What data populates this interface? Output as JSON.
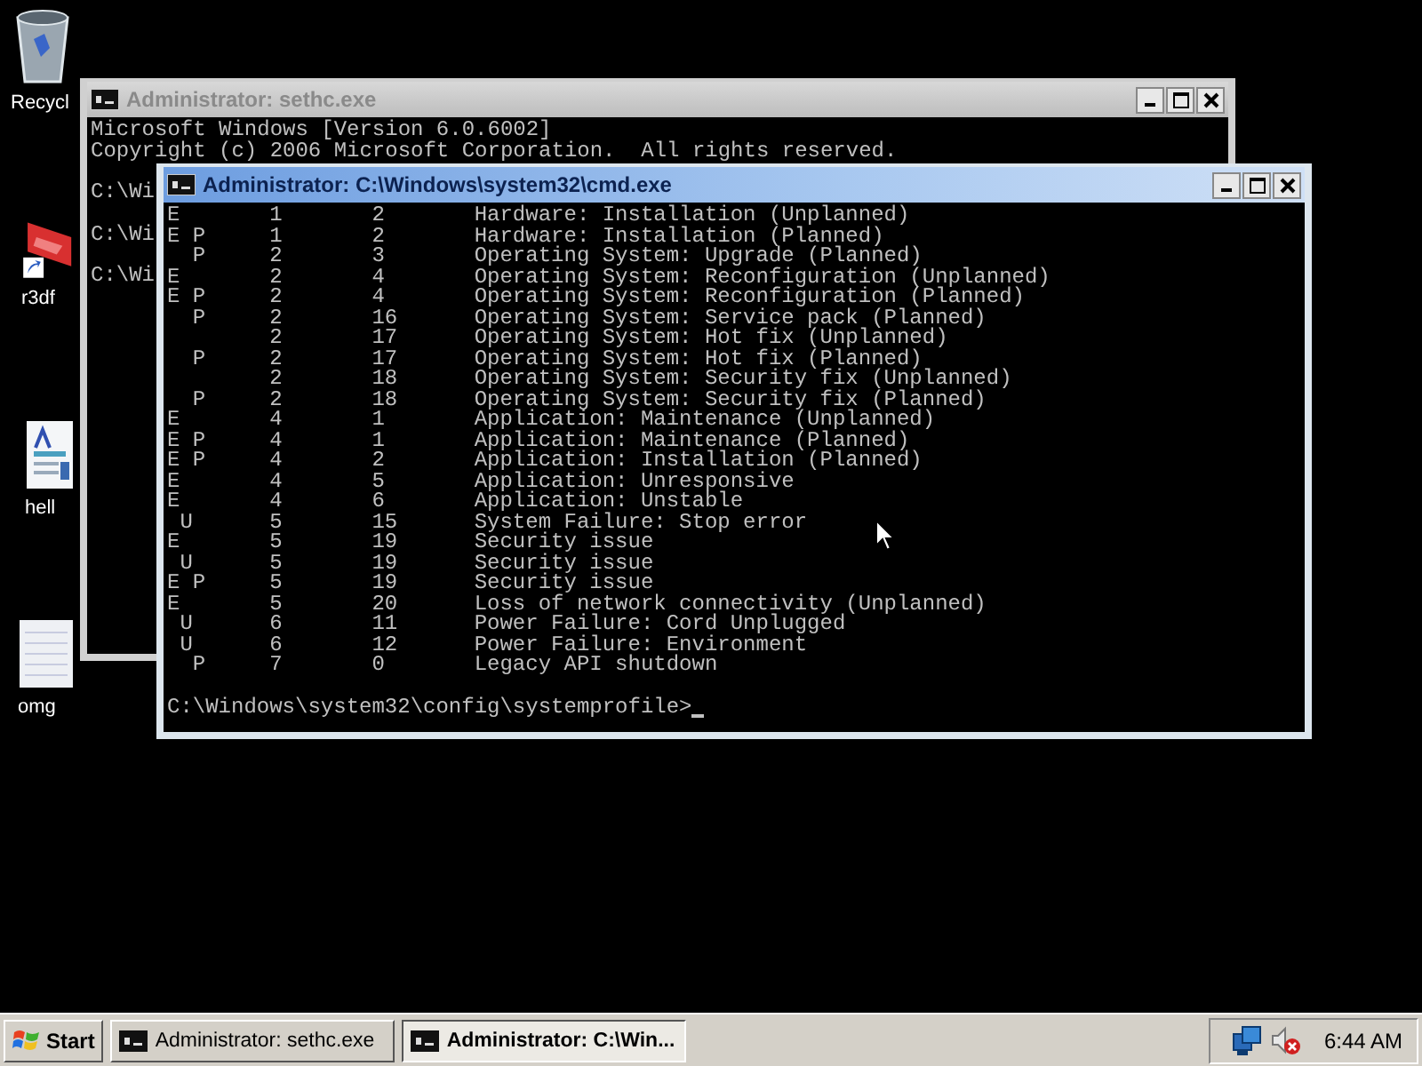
{
  "desktop": {
    "icons": [
      {
        "label": "Recycl",
        "kind": "recycle"
      },
      {
        "label": "r3df",
        "kind": "shortcut"
      },
      {
        "label": "hell",
        "kind": "document"
      },
      {
        "label": "omg",
        "kind": "text"
      }
    ]
  },
  "windows": [
    {
      "title": "Administrator: sethc.exe",
      "active": false,
      "header": [
        "Microsoft Windows [Version 6.0.6002]",
        "Copyright (c) 2006 Microsoft Corporation.  All rights reserved."
      ],
      "prompts": [
        "C:\\Wi",
        "C:\\Wi",
        "C:\\Wi"
      ]
    },
    {
      "title": "Administrator: C:\\Windows\\system32\\cmd.exe",
      "active": true,
      "lines": [
        "E       1       2       Hardware: Installation (Unplanned)",
        "E P     1       2       Hardware: Installation (Planned)",
        "  P     2       3       Operating System: Upgrade (Planned)",
        "E       2       4       Operating System: Reconfiguration (Unplanned)",
        "E P     2       4       Operating System: Reconfiguration (Planned)",
        "  P     2       16      Operating System: Service pack (Planned)",
        "        2       17      Operating System: Hot fix (Unplanned)",
        "  P     2       17      Operating System: Hot fix (Planned)",
        "        2       18      Operating System: Security fix (Unplanned)",
        "  P     2       18      Operating System: Security fix (Planned)",
        "E       4       1       Application: Maintenance (Unplanned)",
        "E P     4       1       Application: Maintenance (Planned)",
        "E P     4       2       Application: Installation (Planned)",
        "E       4       5       Application: Unresponsive",
        "E       4       6       Application: Unstable",
        " U      5       15      System Failure: Stop error",
        "E       5       19      Security issue",
        " U      5       19      Security issue",
        "E P     5       19      Security issue",
        "E       5       20      Loss of network connectivity (Unplanned)",
        " U      6       11      Power Failure: Cord Unplugged",
        " U      6       12      Power Failure: Environment",
        "  P     7       0       Legacy API shutdown"
      ],
      "prompt": "C:\\Windows\\system32\\config\\systemprofile>"
    }
  ],
  "taskbar": {
    "start": "Start",
    "tasks": [
      {
        "label": "Administrator: sethc.exe",
        "selected": false
      },
      {
        "label": "Administrator: C:\\Win...",
        "selected": true
      }
    ],
    "clock": "6:44 AM"
  }
}
